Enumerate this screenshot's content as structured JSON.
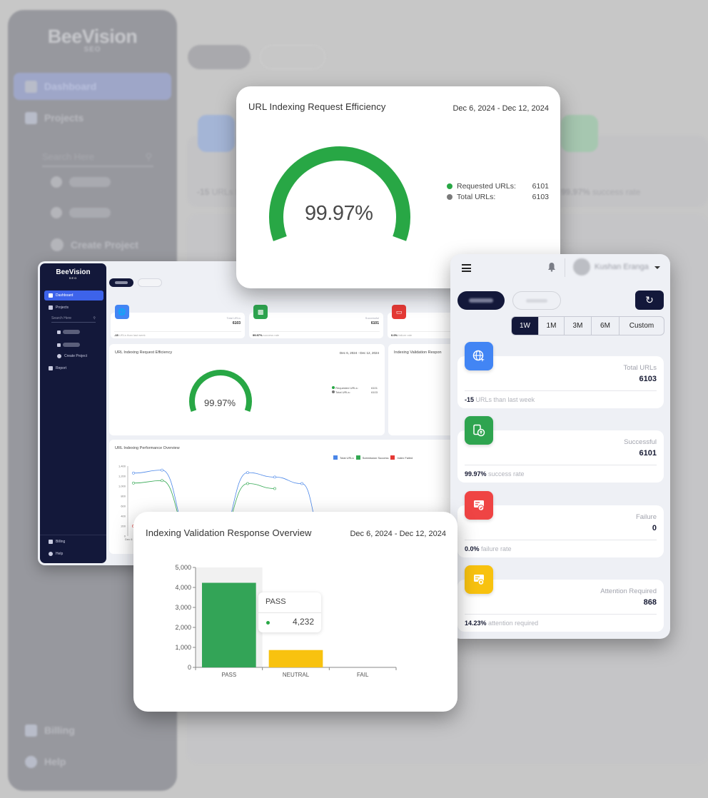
{
  "background": {
    "logo": "BeeVision",
    "logo_sub": "SEO",
    "nav": [
      "Dashboard",
      "Projects",
      "Create Project"
    ],
    "search_placeholder": "Search Here",
    "footer_nav": [
      "Billing",
      "Help"
    ],
    "stat_total_change": "-15",
    "stat_total_change_text": "URLs than last week",
    "stat_success_rate": "99.97%",
    "stat_success_text": "success rate"
  },
  "mini_dashboard": {
    "logo": "BeeVision",
    "logo_sub": "SEO",
    "nav": {
      "dashboard": "Dashboard",
      "projects": "Projects",
      "create_project": "Create Project",
      "report": "Report",
      "billing": "Billing",
      "help": "Help"
    },
    "search_placeholder": "Search Here",
    "stats": [
      {
        "label": "Total URLs",
        "value": "6103",
        "footer_bold": "-15",
        "footer_text": "URLs than last week"
      },
      {
        "label": "Successful",
        "value": "6101",
        "footer_bold": "99.97%",
        "footer_text": "success rate"
      },
      {
        "label": "",
        "value": "",
        "footer_bold": "0.0%",
        "footer_text": "failure rate"
      }
    ],
    "efficiency": {
      "title": "URL Indexing Request Efficiency",
      "date": "Dec 6, 2024 - Dec 12, 2024",
      "percent": "99.97%",
      "legend": [
        {
          "label": "Requested URLs:",
          "value": "6101"
        },
        {
          "label": "Total URLs:",
          "value": "6103"
        }
      ]
    },
    "validation_title": "Indexing Validation Respon",
    "performance": {
      "title": "URL Indexing Performance Overview",
      "legend": [
        "Total URLs",
        "Submission Success",
        "Index Failed"
      ],
      "y_ticks": [
        "1,400",
        "1,200",
        "1,000",
        "800",
        "600",
        "400",
        "200",
        "0"
      ],
      "x_first": "Dec 6"
    }
  },
  "efficiency_card": {
    "title": "URL Indexing Request Efficiency",
    "date_range": "Dec 6, 2024 - Dec 12, 2024",
    "percent_label": "99.97%",
    "percent_value": 99.97,
    "legend": [
      {
        "label": "Requested URLs:",
        "value": "6101",
        "color": "#28a745"
      },
      {
        "label": "Total URLs:",
        "value": "6103",
        "color": "#7a7a7a"
      }
    ]
  },
  "mobile": {
    "user_name": "Kushan Eranga",
    "ranges": [
      "1W",
      "1M",
      "3M",
      "6M",
      "Custom"
    ],
    "active_range": "1W",
    "stats": [
      {
        "label": "Total URLs",
        "value": "6103",
        "footer_bold": "-15",
        "footer_text": "URLs than last week",
        "icon": "globe-icon",
        "color": "#4285f4"
      },
      {
        "label": "Successful",
        "value": "6101",
        "footer_bold": "99.97%",
        "footer_text": "success rate",
        "icon": "upload-device-icon",
        "color": "#2ea44f"
      },
      {
        "label": "Failure",
        "value": "0",
        "footer_bold": "0.0%",
        "footer_text": "failure rate",
        "icon": "failure-card-icon",
        "color": "#ef4444"
      },
      {
        "label": "Attention Required",
        "value": "868",
        "footer_bold": "14.23%",
        "footer_text": "attention required",
        "icon": "attention-card-icon",
        "color": "#f8c20f"
      }
    ]
  },
  "validation_card": {
    "title": "Indexing Validation Response Overview",
    "date_range": "Dec 6, 2024 - Dec 12, 2024",
    "tooltip": {
      "title": "PASS",
      "value": "4,232"
    }
  },
  "chart_data": [
    {
      "type": "bar",
      "title": "Indexing Validation Response Overview",
      "categories": [
        "PASS",
        "NEUTRAL",
        "FAIL"
      ],
      "values": [
        4232,
        868,
        0
      ],
      "colors": [
        "#33a457",
        "#f8c20f",
        "#e53935"
      ],
      "y_ticks": [
        "0",
        "1,000",
        "2,000",
        "3,000",
        "4,000",
        "5,000"
      ],
      "ylim": [
        0,
        5000
      ],
      "xlabel": "",
      "ylabel": "",
      "highlighted": "PASS"
    },
    {
      "type": "line",
      "title": "URL Indexing Performance Overview",
      "legend": [
        "Total URLs",
        "Submission Success",
        "Index Failed"
      ],
      "legend_placement": "top-right",
      "ylim": [
        0,
        1400
      ],
      "y_ticks": [
        "0",
        "200",
        "400",
        "600",
        "800",
        "1,000",
        "1,200",
        "1,400"
      ],
      "x_first_label": "Dec 6",
      "series": [
        {
          "name": "Total URLs",
          "color": "#4a86e8",
          "values": [
            1260,
            1320,
            0,
            0,
            1270,
            1180,
            1050,
            0
          ]
        },
        {
          "name": "Submission Success",
          "color": "#34a853",
          "values": [
            1060,
            1110,
            0,
            0,
            1050,
            950,
            null,
            null
          ]
        },
        {
          "name": "Index Failed",
          "color": "#e53935",
          "values": [
            200
          ]
        }
      ]
    }
  ]
}
